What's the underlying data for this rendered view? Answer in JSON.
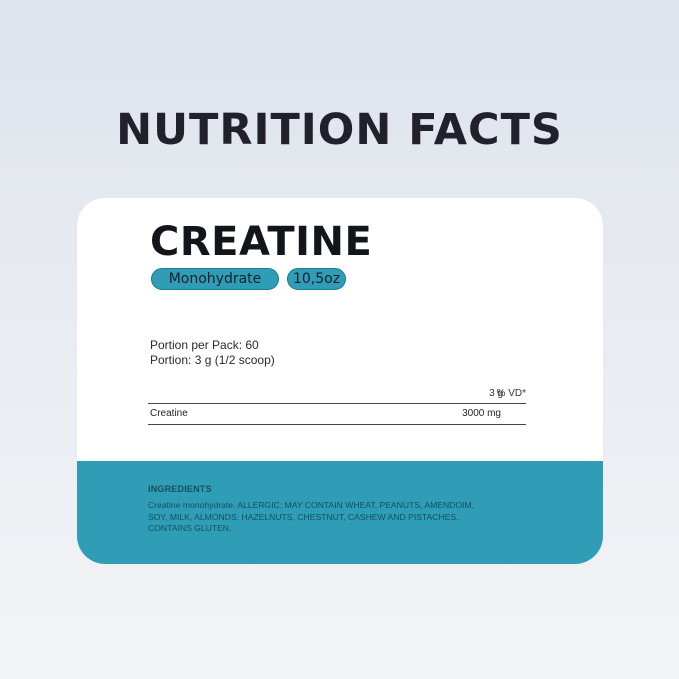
{
  "page": {
    "title": "NUTRITION FACTS"
  },
  "product": {
    "name": "CREATINE",
    "variant": "Monohydrate",
    "size": "10,5oz"
  },
  "portion": {
    "per_pack": "Portion per Pack: 60",
    "portion": "Portion: 3 g (1/2 scoop)"
  },
  "table": {
    "headers": {
      "name": "",
      "amount": "3 g",
      "vd": "% VD*"
    },
    "rows": [
      {
        "name": "Creatine",
        "amount": "3000 mg",
        "vd": ""
      }
    ]
  },
  "ingredients": {
    "title": "INGREDIENTS",
    "text": "Creatine monohydrate. ALLERGIC: MAY CONTAIN WHEAT, PEANUTS, AMENDOIM, SOY, MILK, ALMONDS, HAZELNUTS, CHESTNUT, CASHEW AND PISTACHES. CONTAINS GLUTEN."
  },
  "colors": {
    "background": "#e3e7ee",
    "card": "#ffffff",
    "accent": "#2e9db5",
    "title_text": "#20212b"
  }
}
